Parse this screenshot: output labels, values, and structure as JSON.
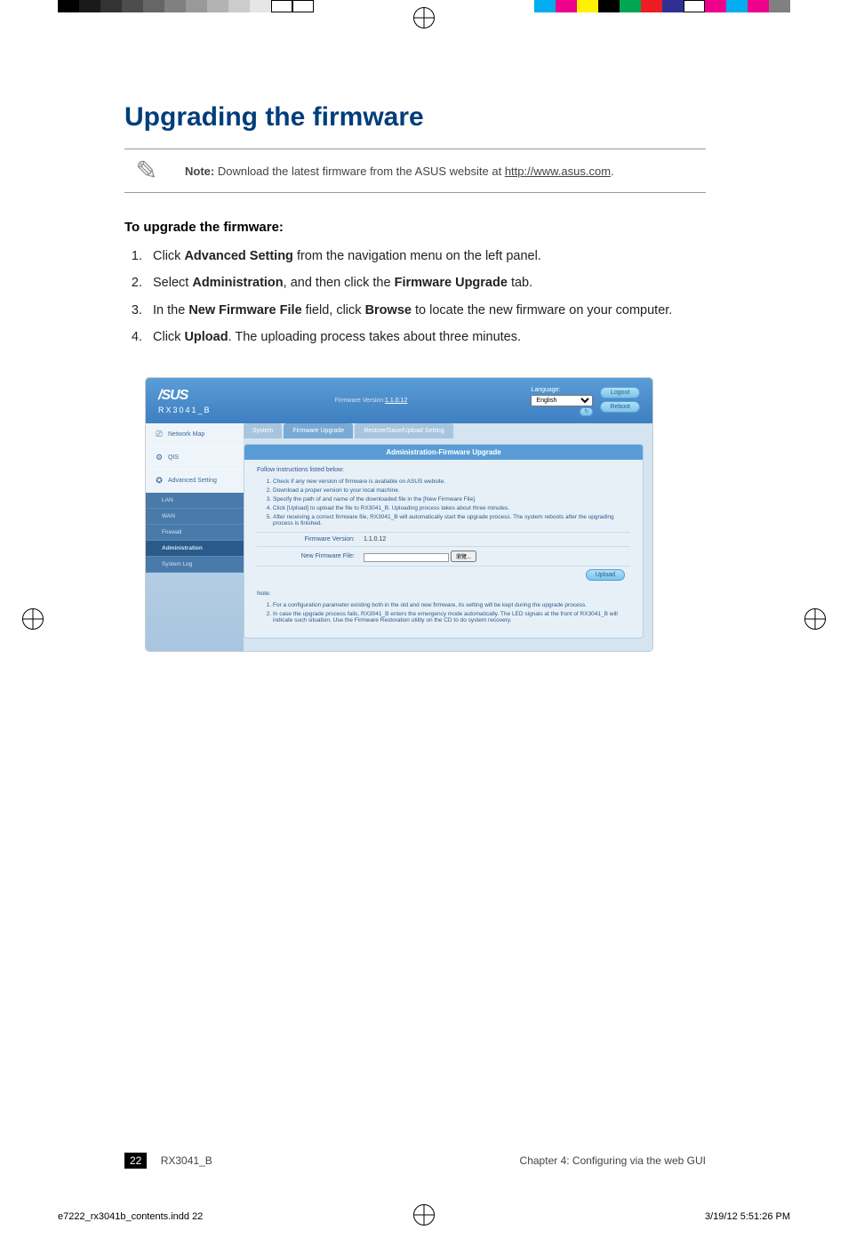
{
  "print_marks": {
    "grayscale": [
      "#000000",
      "#1a1a1a",
      "#333333",
      "#4d4d4d",
      "#666666",
      "#808080",
      "#999999",
      "#b3b3b3",
      "#cccccc",
      "#e6e6e6",
      "#ffffff",
      "#ffffff"
    ],
    "color_bar": [
      "#00aeef",
      "#ec008c",
      "#fff200",
      "#000000",
      "#00a651",
      "#ed1c24",
      "#2e3192",
      "#ffffff",
      "#ec008c",
      "#00aeef",
      "#ec008c",
      "#808080"
    ]
  },
  "heading": "Upgrading the firmware",
  "note": {
    "label": "Note:",
    "text": " Download the latest firmware from the ASUS website at ",
    "link_text": "http://www.asus.com",
    "suffix": "."
  },
  "subheading": "To upgrade the firmware:",
  "steps": [
    {
      "pre": "Click ",
      "bold": "Advanced Setting",
      "post": " from the navigation menu on the left panel."
    },
    {
      "pre": "Select ",
      "bold": "Administration",
      "mid": ", and then click the ",
      "bold2": "Firmware Upgrade",
      "post": " tab."
    },
    {
      "pre": "In the ",
      "bold": "New Firmware File",
      "mid": " field, click ",
      "bold2": "Browse",
      "post": " to locate the new firmware on your computer."
    },
    {
      "pre": "Click ",
      "bold": "Upload",
      "post": ". The uploading process takes about three minutes."
    }
  ],
  "screenshot": {
    "logo": "/SUS",
    "model": "RX3041_B",
    "fw_label": "Firmware Version:",
    "fw_link": "1.1.0.12",
    "language_label": "Language:",
    "language_value": "English",
    "logout_btn": "Logout",
    "reboot_btn": "Reboot",
    "refresh_btn": "↻",
    "sidebar_top": [
      {
        "icon": "⎚",
        "label": "Network Map"
      },
      {
        "icon": "⚙",
        "label": "QIS"
      },
      {
        "icon": "✪",
        "label": "Advanced Setting"
      }
    ],
    "sidebar_sub": [
      {
        "label": "LAN",
        "active": false
      },
      {
        "label": "WAN",
        "active": false
      },
      {
        "label": "Firewall",
        "active": false
      },
      {
        "label": "Administration",
        "active": true
      },
      {
        "label": "System Log",
        "active": false
      }
    ],
    "tabs": [
      {
        "label": "System",
        "active": false
      },
      {
        "label": "Firmware Upgrade",
        "active": true
      },
      {
        "label": "Restore/Save/Upload Setting",
        "active": false
      }
    ],
    "panel_title": "Administration-Firmware Upgrade",
    "follow_text": "Follow instructions listed below:",
    "instructions": [
      "Check if any new version of firmware is available on ASUS website.",
      "Download a proper version to your local machine.",
      "Specify the path of and name of the downloaded file in the [New Firmware File].",
      "Click [Upload] to upload the file to RX3041_B. Uploading process takes about three minutes.",
      "After receiving a correct firmware file, RX3041_B will automatically start the upgrade process. The system reboots after the upgrading process is finished."
    ],
    "form": {
      "fw_version_label": "Firmware Version:",
      "fw_version_value": "1.1.0.12",
      "new_fw_label": "New Firmware File:",
      "browse_btn": "瀏覽...",
      "upload_btn": "Upload"
    },
    "note_label": "Note:",
    "note_items": [
      "For a configuration parameter existing both in the old and new firmware, its setting will be kept during the upgrade process.",
      "In case the upgrade process fails, RX3041_B enters the emergency mode automatically. The LED signals at the front of RX3041_B will indicate such situation. Use the Firmware Restoration utility on the CD to do system recovery."
    ]
  },
  "footer": {
    "page_number": "22",
    "product": "RX3041_B",
    "chapter": "Chapter 4: Configuring via the web GUI"
  },
  "indd": {
    "file": "e7222_rx3041b_contents.indd   22",
    "datetime": "3/19/12   5:51:26 PM"
  }
}
